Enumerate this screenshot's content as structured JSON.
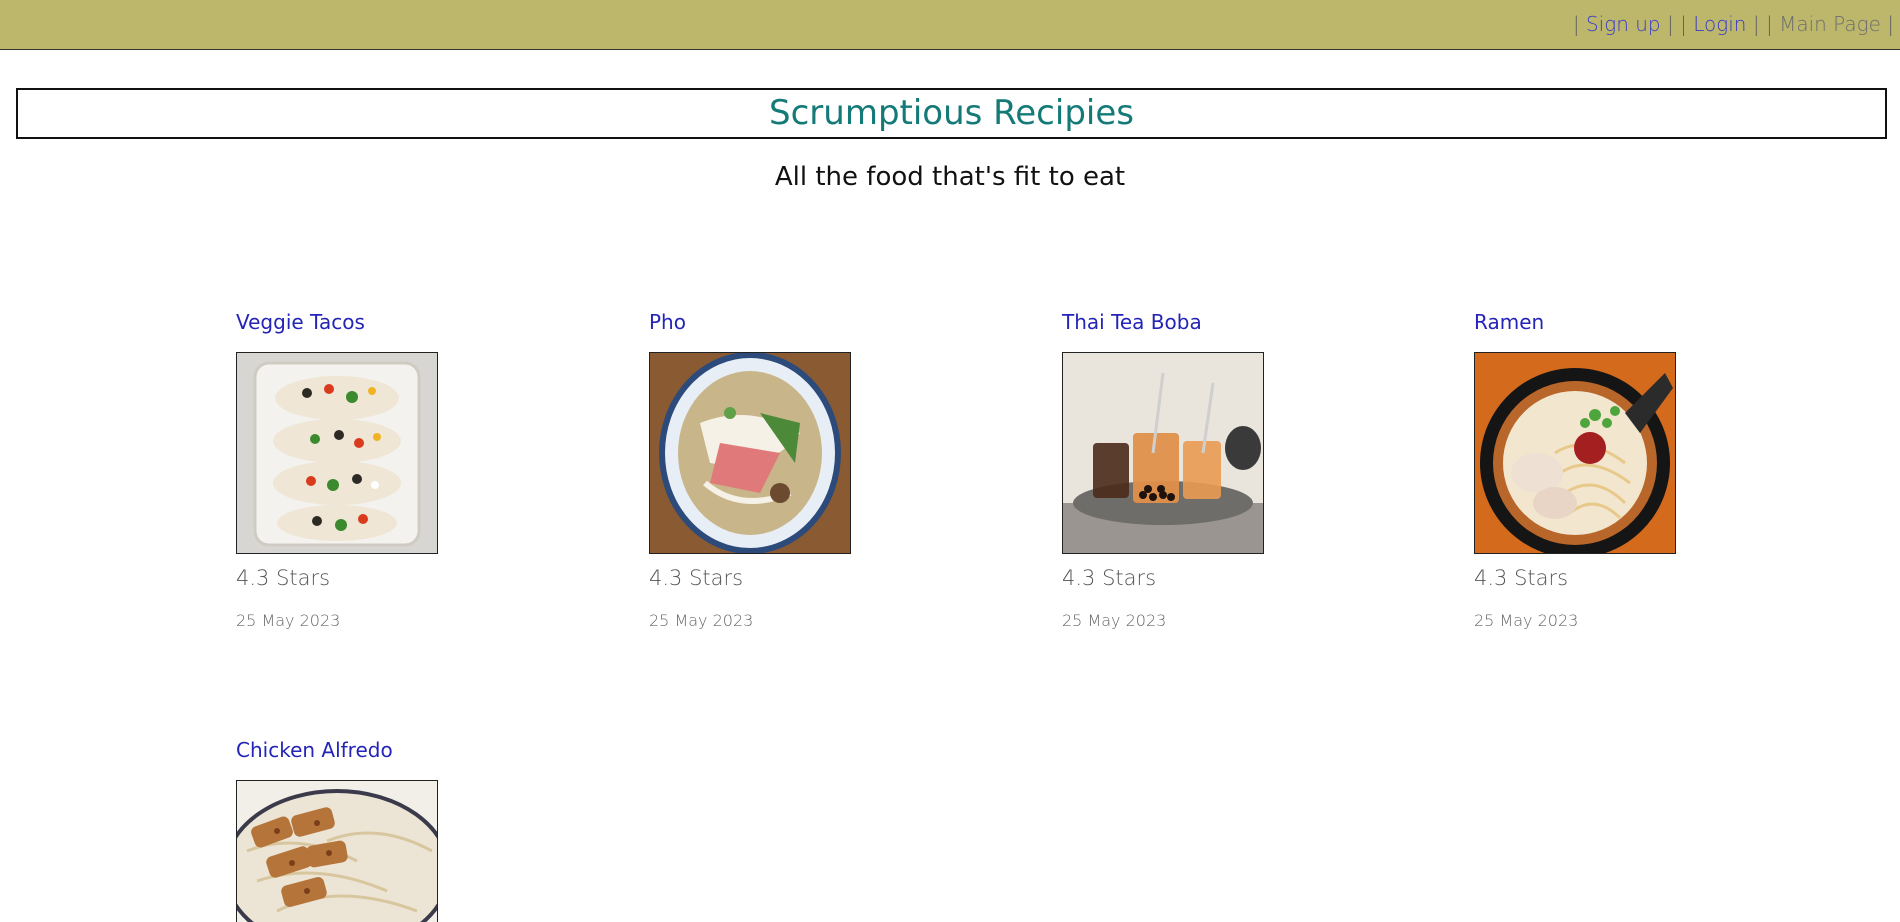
{
  "nav": {
    "pipe": "|",
    "signup": "Sign up",
    "login": "Login",
    "main_page": "Main Page"
  },
  "header": {
    "title": "Scrumptious Recipies",
    "tagline": "All the food that's fit to eat"
  },
  "colors": {
    "topbar_bg": "#bdb76b",
    "title_color": "#147a78",
    "link_color": "#2424b8"
  },
  "recipes": [
    {
      "title": "Veggie Tacos",
      "rating": "4.3 Stars",
      "date": "25 May 2023",
      "image_icon": "veggie-tacos-photo"
    },
    {
      "title": "Pho",
      "rating": "4.3 Stars",
      "date": "25 May 2023",
      "image_icon": "pho-photo"
    },
    {
      "title": "Thai Tea Boba",
      "rating": "4.3 Stars",
      "date": "25 May 2023",
      "image_icon": "thai-tea-boba-photo"
    },
    {
      "title": "Ramen",
      "rating": "4.3 Stars",
      "date": "25 May 2023",
      "image_icon": "ramen-photo"
    },
    {
      "title": "Chicken Alfredo",
      "rating": "",
      "date": "",
      "image_icon": "chicken-alfredo-photo"
    }
  ]
}
